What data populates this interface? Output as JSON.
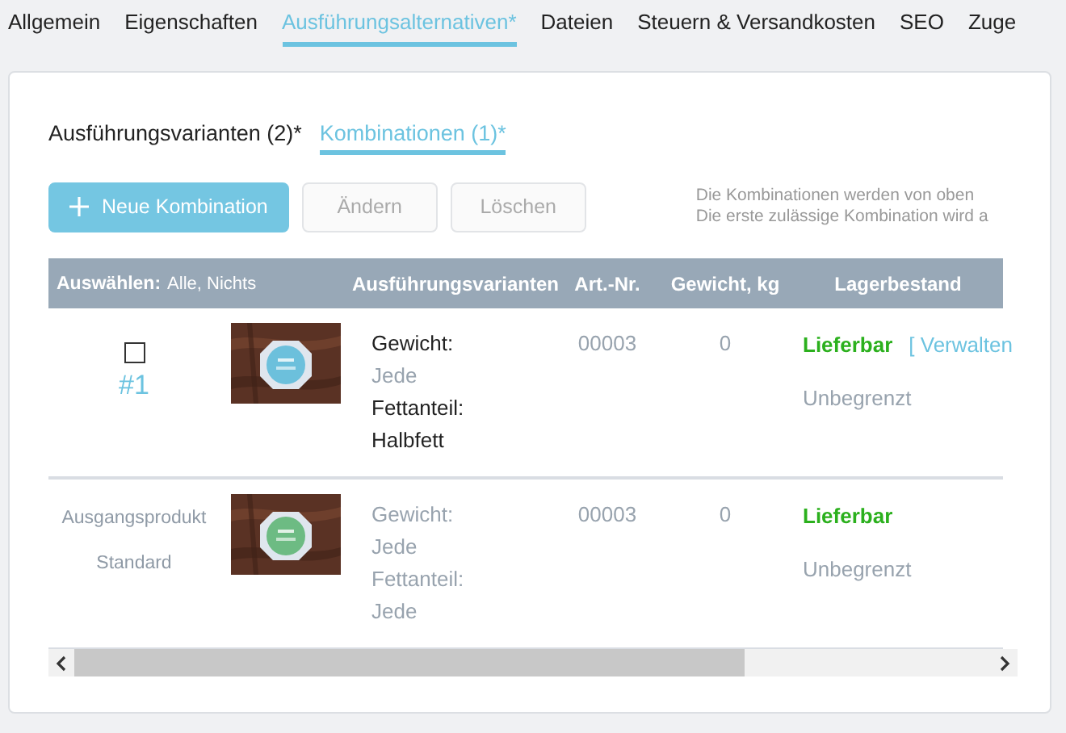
{
  "tabs": [
    {
      "label": "Allgemein",
      "selected": false
    },
    {
      "label": "Eigenschaften",
      "selected": false
    },
    {
      "label": "Ausführungsalternativen*",
      "selected": true
    },
    {
      "label": "Dateien",
      "selected": false
    },
    {
      "label": "Steuern & Versandkosten",
      "selected": false
    },
    {
      "label": "SEO",
      "selected": false
    },
    {
      "label": "Zuge",
      "selected": false
    }
  ],
  "subtabs": [
    {
      "label": "Ausführungsvarianten (2)*",
      "selected": false
    },
    {
      "label": "Kombinationen (1)*",
      "selected": true
    }
  ],
  "buttons": [
    {
      "label": "Neue Kombination",
      "primary": true,
      "disabled": false
    },
    {
      "label": "Ändern",
      "primary": false,
      "disabled": true
    },
    {
      "label": "Löschen",
      "primary": false,
      "disabled": true
    }
  ],
  "note": [
    "Die Kombinationen werden von oben",
    "Die erste zulässige Kombination wird a"
  ],
  "table": {
    "select_header": {
      "label": "Auswählen:",
      "links": "Alle, Nichts"
    },
    "columns": [
      "Ausführungsvarianten",
      "Art.-Nr.",
      "Gewicht, kg",
      "Lagerbestand"
    ],
    "rows": [
      {
        "kind": "combination",
        "checked": false,
        "number": "#1",
        "variants": [
          {
            "text": "Gewicht:",
            "muted": false
          },
          {
            "text": "Jede",
            "muted": true
          },
          {
            "text": "Fettanteil:",
            "muted": false
          },
          {
            "text": "Halbfett",
            "muted": false
          }
        ],
        "article": "00003",
        "weight": "0",
        "stock": {
          "status": "Lieferbar",
          "manage_link": "[ Verwalten",
          "quantity": "Unbegrenzt"
        }
      },
      {
        "kind": "base",
        "labels": [
          "Ausgangsprodukt",
          "Standard"
        ],
        "variants": [
          {
            "text": "Gewicht:",
            "muted": true
          },
          {
            "text": "Jede",
            "muted": true
          },
          {
            "text": "Fettanteil:",
            "muted": true
          },
          {
            "text": "Jede",
            "muted": true
          }
        ],
        "article": "00003",
        "weight": "0",
        "stock": {
          "status": "Lieferbar",
          "quantity": "Unbegrenzt"
        }
      }
    ]
  }
}
